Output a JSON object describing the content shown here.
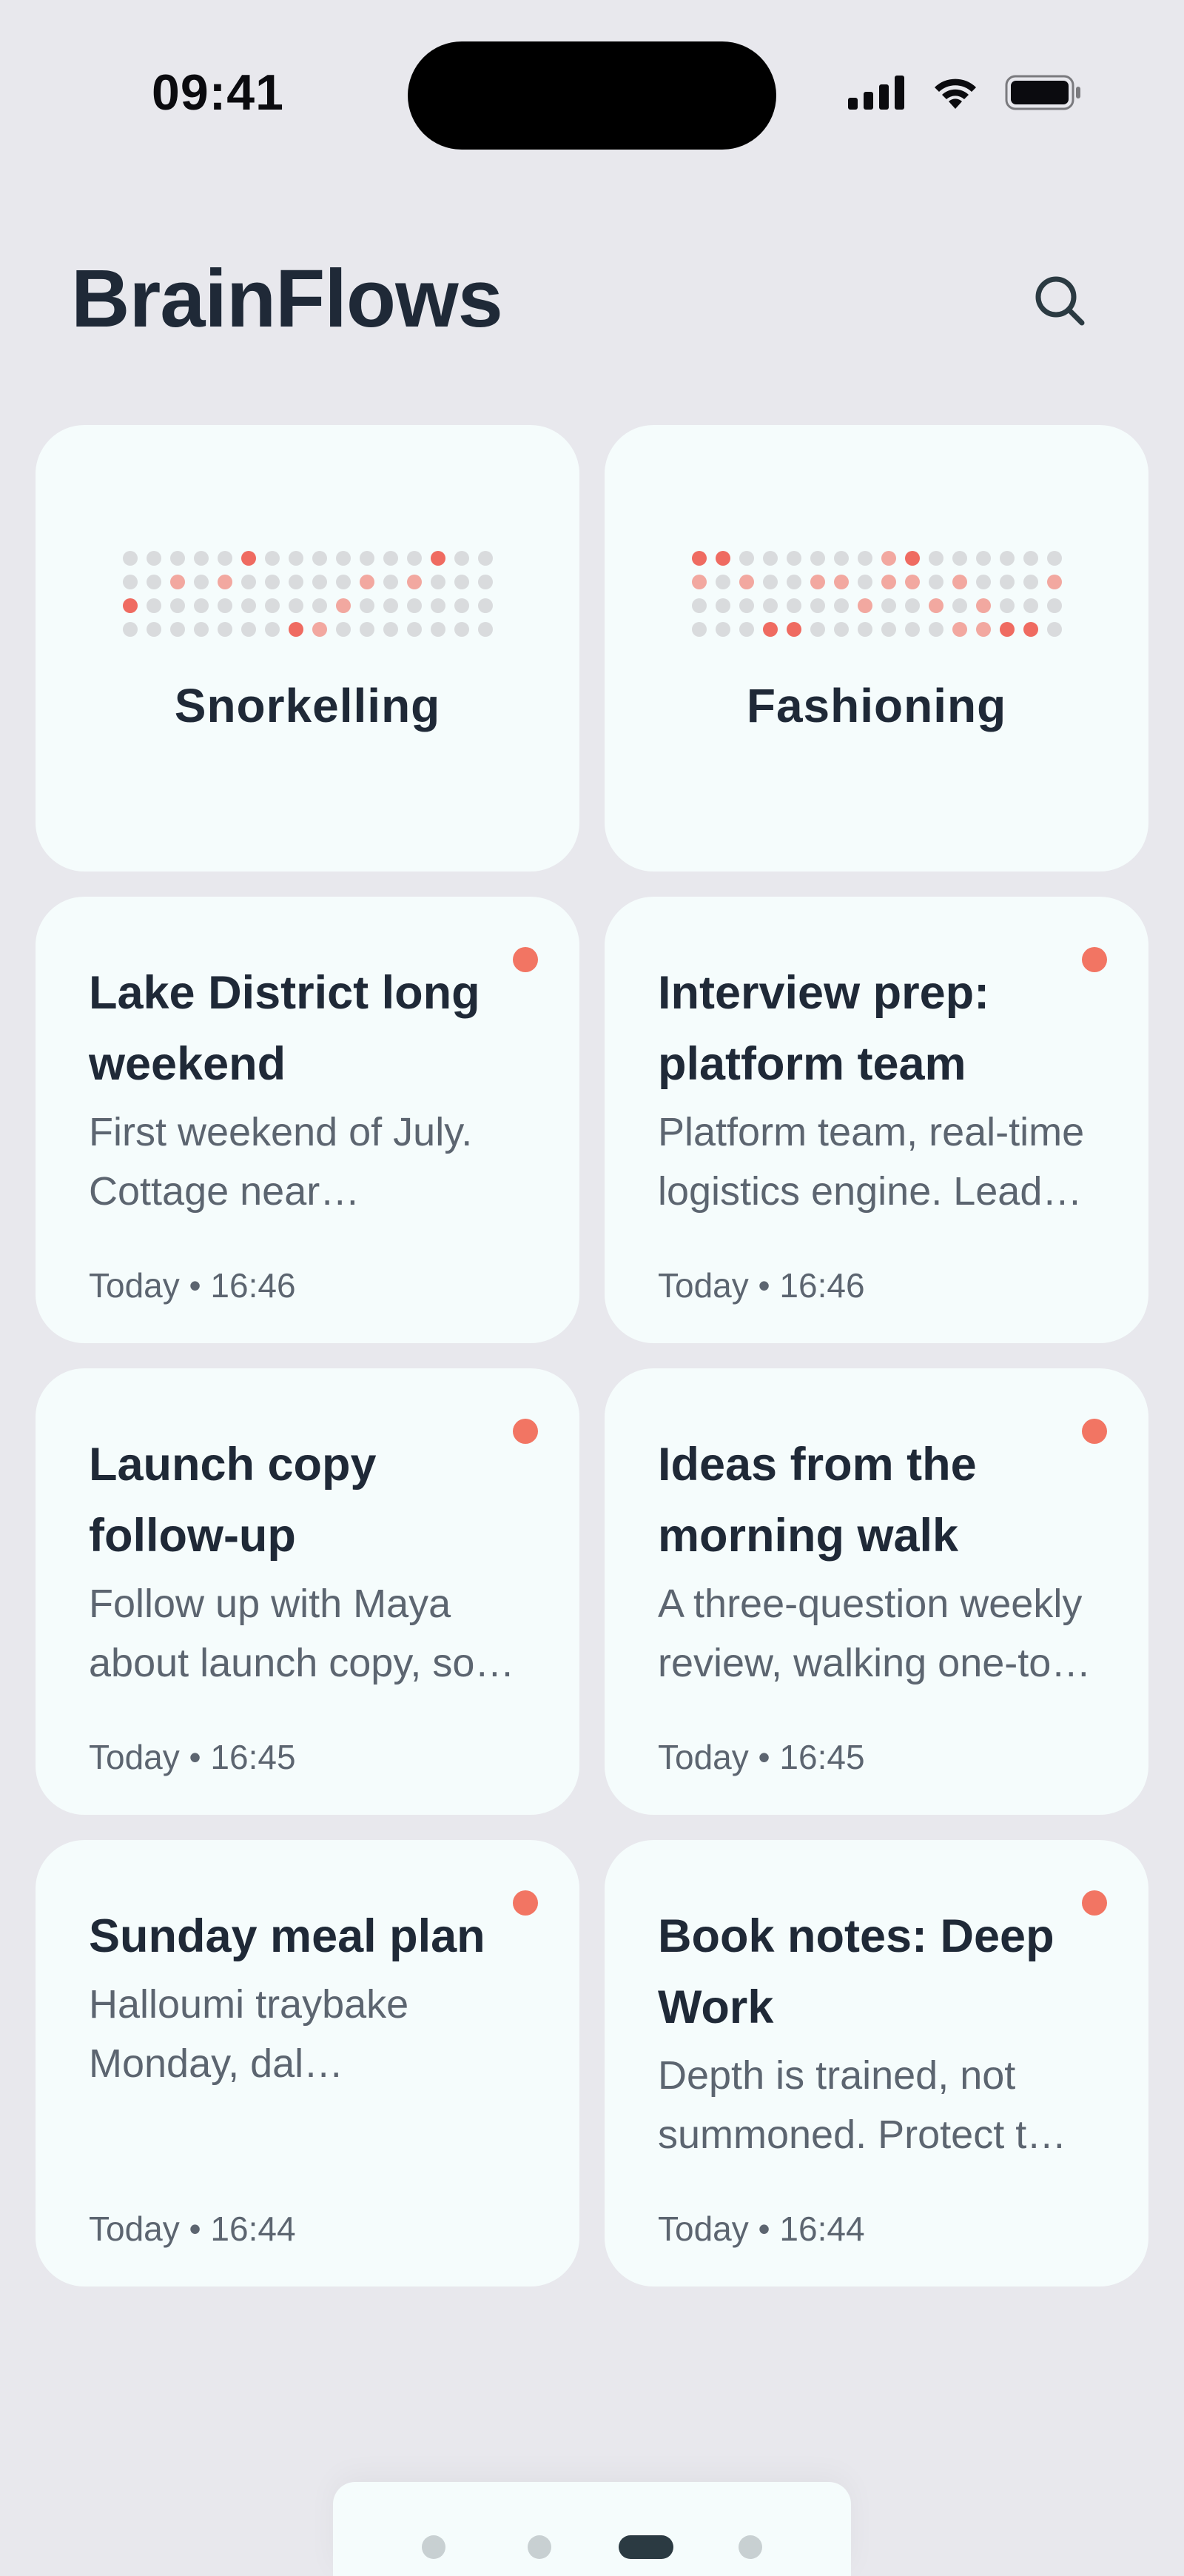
{
  "status_bar": {
    "time": "09:41",
    "icons": [
      "cellular-signal-icon",
      "wifi-icon",
      "battery-icon"
    ]
  },
  "header": {
    "title": "BrainFlows",
    "search_icon": "search-icon"
  },
  "flows": [
    {
      "label": "Snorkelling",
      "pattern": [
        "0000020000000200",
        "0010100000101000",
        "2000000001000000",
        "0000000210000000"
      ]
    },
    {
      "label": "Fashioning",
      "pattern": [
        "2200000012000000",
        "1010011011010001",
        "0000000100101000",
        "0002200000011220"
      ]
    }
  ],
  "notes": [
    {
      "title": "Lake District long weekend",
      "body": "First weekend of July. Cottage near Ambleside, three nights...",
      "time": "Today • 16:46",
      "unread": true
    },
    {
      "title": "Interview prep: platform team",
      "body": "Platform team, real-time logistics engine. Lead engineer...",
      "time": "Today • 16:46",
      "unread": true
    },
    {
      "title": "Launch copy follow-up",
      "body": "Follow up with Maya about launch copy, so we can...",
      "time": "Today • 16:45",
      "unread": true
    },
    {
      "title": "Ideas from the morning walk",
      "body": "A three-question weekly review, walking one-to-ones...",
      "time": "Today • 16:45",
      "unread": true
    },
    {
      "title": "Sunday meal plan",
      "body": "Halloumi traybake Monday, dal Wednesday...",
      "time": "Today • 16:44",
      "unread": true
    },
    {
      "title": "Book notes: Deep Work",
      "body": "Depth is trained, not summoned. Protect two hours...",
      "time": "Today • 16:44",
      "unread": true
    }
  ],
  "pager": {
    "count": 4,
    "active_index": 2
  },
  "colors": {
    "background": "#e8e8ed",
    "card": "#f5fcfc",
    "accent": "#f27563",
    "dot_strong": "#ef6b61",
    "dot_light": "#f2a8a0",
    "dot_idle": "#d9dbdd",
    "text_primary": "#1f2937",
    "text_secondary": "#5c6570"
  }
}
